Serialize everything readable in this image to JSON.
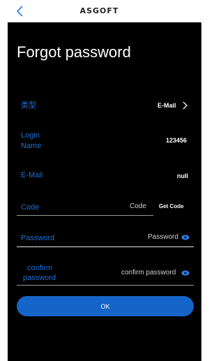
{
  "header": {
    "logo_text": "ASGOFT",
    "back_icon": "chevron-left-icon"
  },
  "page": {
    "title": "Forgot password"
  },
  "form": {
    "type": {
      "label": "类型",
      "value": "E-Mail"
    },
    "login_name": {
      "label_line1": "Login",
      "label_line2": "Name",
      "value": "123456"
    },
    "email": {
      "label": "E-Mail",
      "value": "null"
    },
    "code": {
      "label": "Code",
      "placeholder": "Code",
      "get_code_label": "Get Code"
    },
    "password": {
      "label": "Password",
      "placeholder": "Password"
    },
    "confirm_password": {
      "label_line1": "confirm",
      "label_line2": "password",
      "placeholder": "confirm password"
    }
  },
  "actions": {
    "ok_label": "OK"
  },
  "colors": {
    "accent": "#1565c8",
    "label_blue": "#1f6fd6",
    "background": "#000000",
    "text": "#ffffff"
  }
}
